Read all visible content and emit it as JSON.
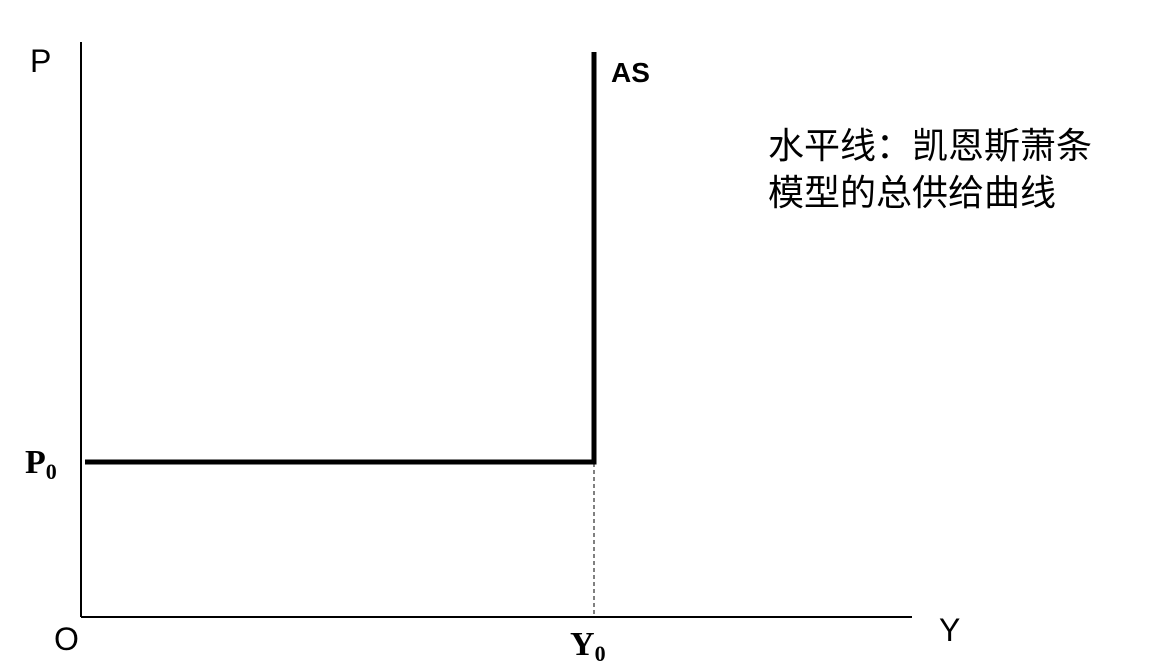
{
  "diagram": {
    "y_axis_label": "P",
    "x_axis_label": "Y",
    "origin_label": "O",
    "curve_label": "AS",
    "price_level_label": {
      "base": "P",
      "sub": "0"
    },
    "output_level_label": {
      "base": "Y",
      "sub": "0"
    },
    "annotation": {
      "line1": "水平线：凯恩斯萧条",
      "line2": "模型的总供给曲线"
    }
  }
}
